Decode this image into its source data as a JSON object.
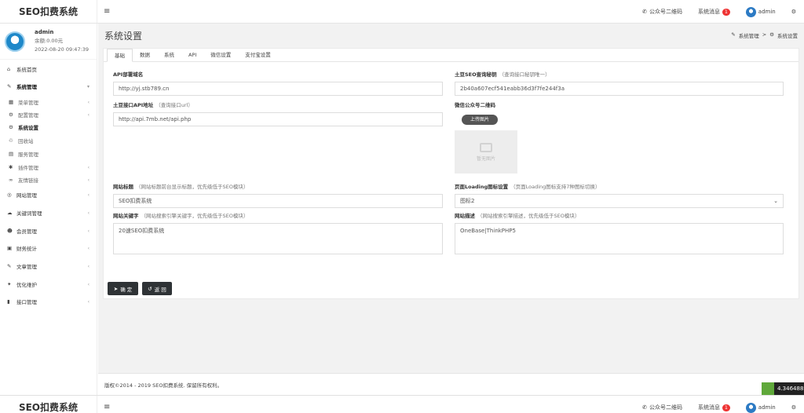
{
  "app": {
    "title": "SEO扣费系统",
    "menu_icon": "≡"
  },
  "topbar": {
    "qrcode_label": "公众号二维码",
    "messages_label": "系统消息",
    "messages_count": "1",
    "user_label": "admin"
  },
  "profile": {
    "name": "admin",
    "balance": "余额:0.00元",
    "datetime": "2022-08-20 09:47:39"
  },
  "sidebar": {
    "home": "系统首页",
    "system_manage": "系统管理",
    "menu_manage": "菜单管理",
    "config_manage": "配置管理",
    "system_settings": "系统设置",
    "recycle": "回收站",
    "service_manage": "服务管理",
    "plugin_manage": "插件管理",
    "friend_links": "友情链接",
    "site_manage": "网站管理",
    "keyword_manage": "关键词管理",
    "member_manage": "会员管理",
    "finance_stats": "财务统计",
    "article_manage": "文章管理",
    "optimize_maintain": "优化维护",
    "api_manage": "接口管理"
  },
  "page": {
    "title": "系统设置",
    "breadcrumb": {
      "parent": "系统管理",
      "separator": ">",
      "current": "系统设置"
    }
  },
  "tabs": [
    "基础",
    "数据",
    "系统",
    "API",
    "微信设置",
    "支付宝设置"
  ],
  "form": {
    "api_domain": {
      "label": "API部署域名",
      "hint": "",
      "value": "http://yj.stb789.cn"
    },
    "seo_key": {
      "label": "土豆SEO查询秘钥",
      "hint": "（查询接口秘钥唯一）",
      "value": "2b40a607ecf541eabb36d3f7fe244f3a"
    },
    "api_address": {
      "label": "土豆接口API地址",
      "hint": "（查询接口url）",
      "value": "http://api.7mb.net/api.php"
    },
    "wechat_qr": {
      "label": "微信公众号二维码",
      "upload_label": "上传图片",
      "placeholder_label": "暂无图片"
    },
    "site_title": {
      "label": "网站标题",
      "hint": "（网站标题前台显示标题，优先级低于SEO模块）",
      "value": "SEO扣费系统"
    },
    "loading_icon": {
      "label": "页面Loading图标设置",
      "hint": "（页面Loading图标支持7种图标切换）",
      "value": "图标2"
    },
    "site_keywords": {
      "label": "网站关键字",
      "hint": "（网站搜索引擎关键字，优先级低于SEO模块）",
      "value": "20速SEO扣费系统"
    },
    "site_description": {
      "label": "网站描述",
      "hint": "（网站搜索引擎描述，优先级低于SEO模块）",
      "value": "OneBase|ThinkPHP5"
    }
  },
  "actions": {
    "confirm": "确 定",
    "back": "返 回"
  },
  "footer": {
    "copyright": "版权©2014 - 2019 SEO扣费系统. 保留所有权利。"
  },
  "corner_widget": {
    "value": "4.346488"
  },
  "colors": {
    "dark_button": "#2f3336",
    "badge": "#e33333",
    "widget_green": "#5fa83a"
  }
}
